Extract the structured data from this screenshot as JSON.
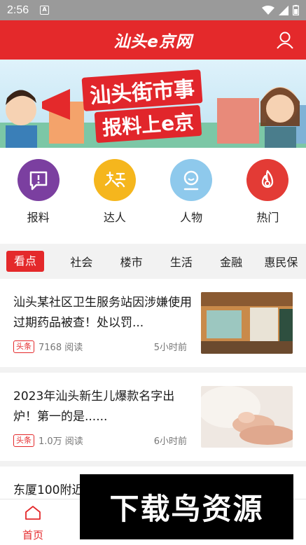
{
  "status_bar": {
    "time": "2:56",
    "notif_glyph": "A"
  },
  "header": {
    "logo_text": "汕头e京网",
    "user_icon": "user-icon"
  },
  "banner": {
    "line1": "汕头街市事",
    "line2": "报料上e京"
  },
  "quick_entries": [
    {
      "label": "报料",
      "icon": "report-icon",
      "color": "#7b3fa0"
    },
    {
      "label": "达人",
      "icon": "expert-icon",
      "color": "#f5b61d"
    },
    {
      "label": "人物",
      "icon": "person-icon",
      "color": "#8ec9ec"
    },
    {
      "label": "热门",
      "icon": "fire-icon",
      "color": "#e33b35"
    }
  ],
  "tabs": [
    "看点",
    "社会",
    "楼市",
    "生活",
    "金融",
    "惠民保"
  ],
  "news": [
    {
      "title": "汕头某社区卫生服务站因涉嫌使用过期药品被查！处以罚...",
      "tag": "头条",
      "reads": "7168 阅读",
      "time": "5小时前"
    },
    {
      "title": "2023年汕头新生儿爆款名字出炉！第一的是......",
      "tag": "头条",
      "reads": "1.0万 阅读",
      "time": "6小时前"
    },
    {
      "title": "东厦100附近"
    }
  ],
  "bottom_nav": {
    "home_label": "首页"
  },
  "watermark": {
    "text": "下载鸟资源"
  },
  "colors": {
    "accent": "#e4292b"
  }
}
